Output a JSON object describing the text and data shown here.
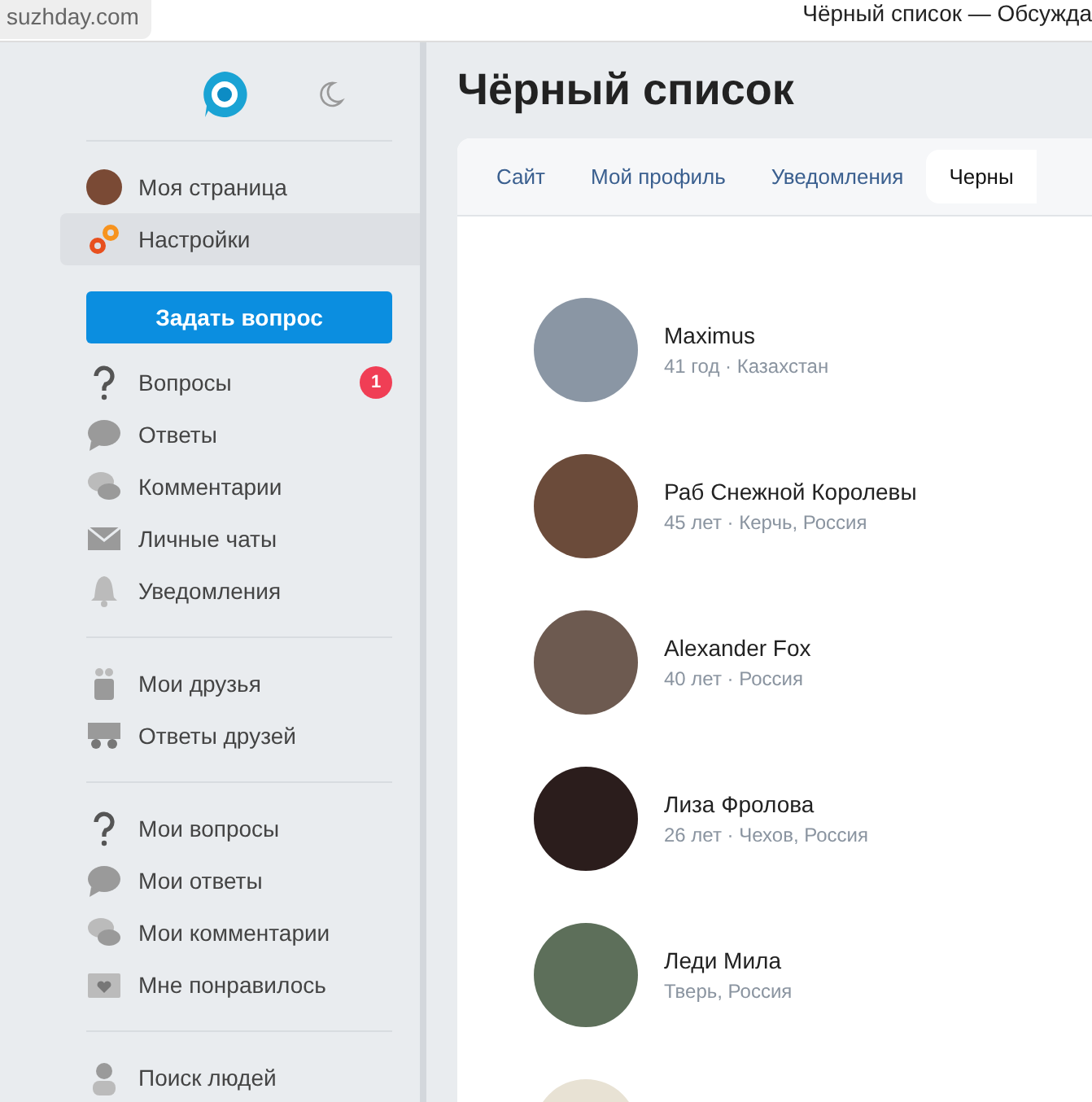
{
  "browser": {
    "address": "suzhday.com",
    "title": "Чёрный список — Обсужда"
  },
  "sidebar": {
    "profile": [
      {
        "label": "Моя страница",
        "kind": "avatar",
        "selected": false
      },
      {
        "label": "Настройки",
        "kind": "gears",
        "selected": true
      }
    ],
    "ask_button": "Задать вопрос",
    "groups": [
      [
        {
          "label": "Вопросы",
          "kind": "question",
          "badge": "1"
        },
        {
          "label": "Ответы",
          "kind": "bubble"
        },
        {
          "label": "Комментарии",
          "kind": "comments"
        },
        {
          "label": "Личные чаты",
          "kind": "mail"
        },
        {
          "label": "Уведомления",
          "kind": "bell"
        }
      ],
      [
        {
          "label": "Мои друзья",
          "kind": "friends"
        },
        {
          "label": "Ответы друзей",
          "kind": "friend-answers"
        }
      ],
      [
        {
          "label": "Мои вопросы",
          "kind": "question"
        },
        {
          "label": "Мои ответы",
          "kind": "bubble"
        },
        {
          "label": "Мои комментарии",
          "kind": "comments"
        },
        {
          "label": "Мне понравилось",
          "kind": "heart-folder"
        }
      ],
      [
        {
          "label": "Поиск людей",
          "kind": "person"
        }
      ]
    ]
  },
  "page": {
    "title": "Чёрный список",
    "tabs": [
      {
        "label": "Сайт",
        "selected": false
      },
      {
        "label": "Мой профиль",
        "selected": false
      },
      {
        "label": "Уведомления",
        "selected": false
      },
      {
        "label": "Черны",
        "selected": true
      }
    ],
    "users": [
      {
        "name": "Maximus",
        "details": "41 год · Казахстан"
      },
      {
        "name": "Раб Снежной Королевы",
        "details": "45 лет · Керчь, Россия"
      },
      {
        "name": "Alexander Fox",
        "details": "40 лет · Россия"
      },
      {
        "name": "Лиза Фролова",
        "details": "26 лет · Чехов, Россия"
      },
      {
        "name": "Леди Мила",
        "details": "Тверь, Россия"
      }
    ]
  }
}
